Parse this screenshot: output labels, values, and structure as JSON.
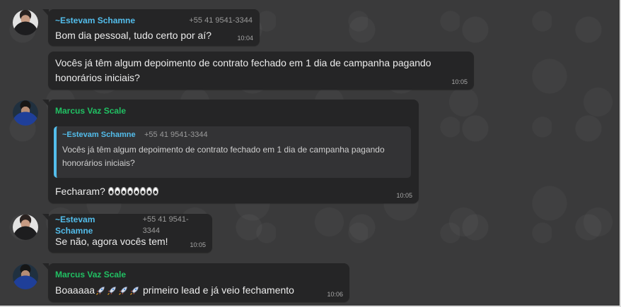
{
  "messages": [
    {
      "sender": "~Estevam Schamne",
      "phone": "+55 41 9541-3344",
      "text": "Bom dia pessoal, tudo certo por aí?",
      "time": "10:04"
    },
    {
      "text": "Vocês já têm algum depoimento de contrato fechado em 1 dia de campanha pagando\nhonorários iniciais?",
      "time": "10:05"
    },
    {
      "sender": "Marcus Vaz Scale",
      "quote": {
        "sender": "~Estevam Schamne",
        "phone": "+55 41 9541-3344",
        "text": "Vocês já têm algum depoimento de contrato fechado em 1 dia de campanha pagando honorários iniciais?"
      },
      "text": "Fecharam?",
      "time": "10:05"
    },
    {
      "sender": "~Estevam Schamne",
      "phone": "+55 41 9541-3344",
      "text": "Se não, agora vocês tem!",
      "time": "10:05"
    },
    {
      "sender": "Marcus Vaz Scale",
      "text_before": "Boaaaaa",
      "text_after": " primeiro lead e já veio fechamento",
      "time": "10:06"
    }
  ],
  "icons": {
    "eyes": "eyes-emoji-icon",
    "rocket": "rocket-emoji-icon"
  },
  "colors": {
    "background": "#3a3a3b",
    "bubble": "#252526",
    "sender_estevam": "#53bdeb",
    "sender_marcus": "#21c063"
  }
}
